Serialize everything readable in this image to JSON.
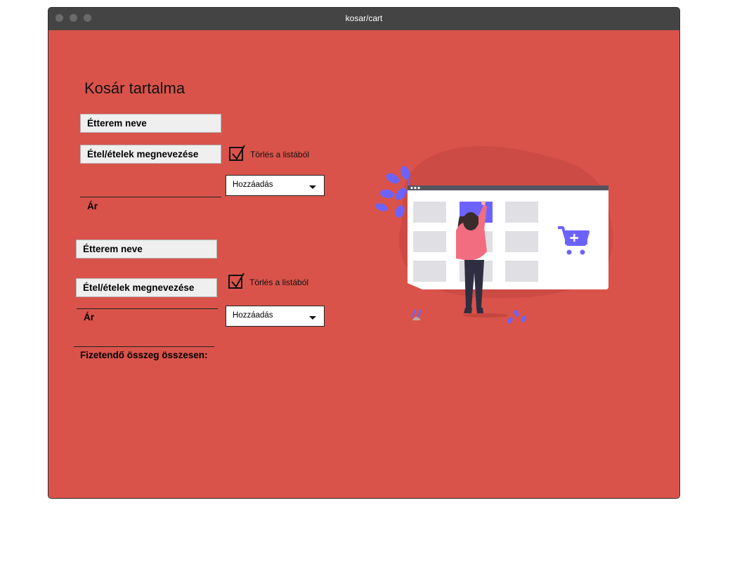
{
  "window": {
    "title": "kosar/cart"
  },
  "cart": {
    "heading": "Kosár tartalma",
    "items": [
      {
        "restaurant": "Étterem neve",
        "food": "Étel/ételek megnevezése",
        "remove_label": "Törlés a listából",
        "remove_checked": true,
        "add_select_value": "Hozzáadás",
        "price_label": "Ár"
      },
      {
        "restaurant": "Étterem neve",
        "food": "Étel/ételek megnevezése",
        "remove_label": "Törlés a listából",
        "remove_checked": true,
        "add_select_value": "Hozzáadás",
        "price_label": "Ár"
      }
    ],
    "total_label": "Fizetendő összeg összesen:"
  },
  "colors": {
    "background": "#d9534a",
    "titlebar": "#444444",
    "accent": "#6c63ff",
    "figure": "#f36d81"
  },
  "illustration": {
    "icon": "shopping-cart-plus-icon"
  }
}
